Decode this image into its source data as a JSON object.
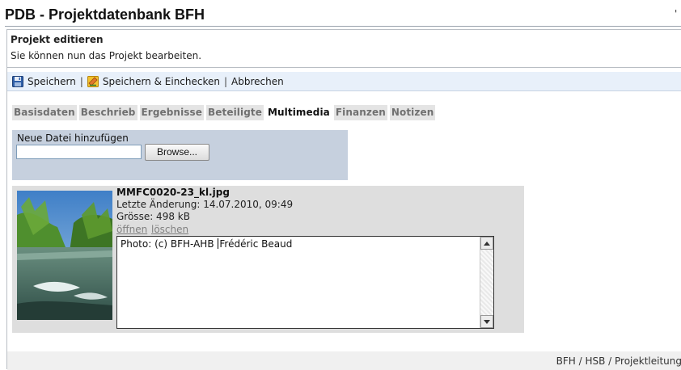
{
  "app": {
    "title": "PDB - Projektdatenbank BFH",
    "corner_mark": "'"
  },
  "section": {
    "title": "Projekt editieren",
    "subtitle": "Sie können nun das Projekt bearbeiten."
  },
  "toolbar": {
    "save_label": "Speichern",
    "save_checkin_label": "Speichern & Einchecken",
    "cancel_label": "Abbrechen",
    "separator": "|",
    "save_icon": "floppy-disk-icon",
    "checkin_icon": "checkin-icon"
  },
  "tabs": [
    {
      "label": "Basisdaten",
      "active": false
    },
    {
      "label": "Beschrieb",
      "active": false
    },
    {
      "label": "Ergebnisse",
      "active": false
    },
    {
      "label": "Beteiligte",
      "active": false
    },
    {
      "label": "Multimedia",
      "active": true
    },
    {
      "label": "Finanzen",
      "active": false
    },
    {
      "label": "Notizen",
      "active": false
    }
  ],
  "upload": {
    "label": "Neue Datei hinzufügen",
    "file_value": "",
    "browse_label": "Browse..."
  },
  "media": {
    "file_name": "MMFC0020-23_kl.jpg",
    "modified": "Letzte Änderung: 14.07.2010, 09:49",
    "size": "Grösse: 498 kB",
    "open_label": "öffnen",
    "delete_label": "löschen",
    "description_before_caret": "Photo: (c) BFH-AHB ",
    "description_after_caret": "Frédéric Beaud"
  },
  "footer": {
    "text": "BFH / HSB / Projektleitung"
  },
  "colors": {
    "toolbar_bg": "#e8f0fa",
    "upload_bg": "#c6d0de",
    "card_bg": "#dedede",
    "tab_bg": "#e4e4e4",
    "footer_bg": "#f0f0f0"
  }
}
